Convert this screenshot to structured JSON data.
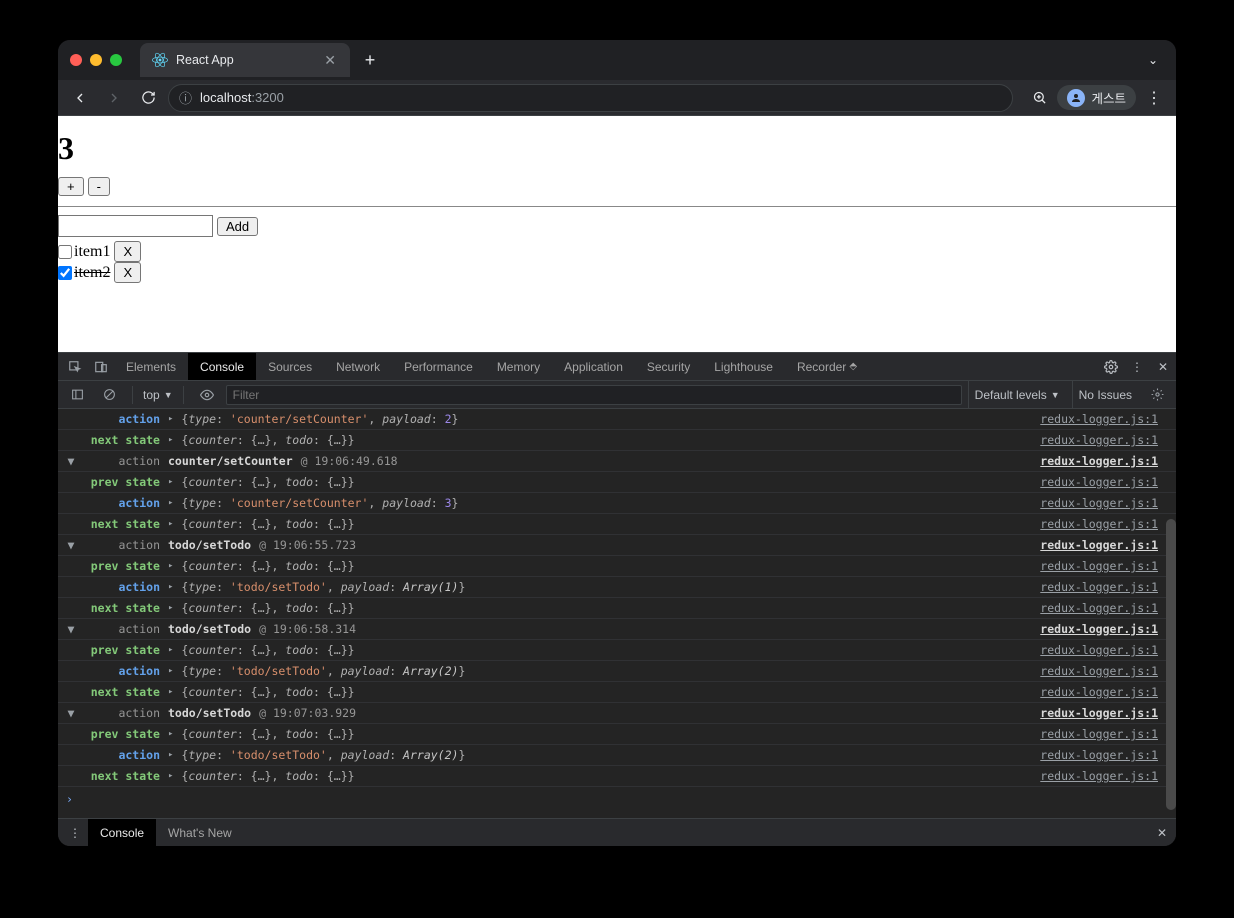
{
  "browser": {
    "tab_title": "React App",
    "url_host": "localhost",
    "url_path": ":3200",
    "guest_label": "게스트"
  },
  "app": {
    "counter": "3",
    "inc_label": "+",
    "dec_label": "-",
    "add_label": "Add",
    "todos": [
      {
        "label": "item1",
        "checked": false,
        "remove": "X"
      },
      {
        "label": "item2",
        "checked": true,
        "remove": "X"
      }
    ]
  },
  "devtools": {
    "tabs": [
      "Elements",
      "Console",
      "Sources",
      "Network",
      "Performance",
      "Memory",
      "Application",
      "Security",
      "Lighthouse",
      "Recorder"
    ],
    "active_tab": "Console",
    "context": "top",
    "filter_placeholder": "Filter",
    "levels": "Default levels",
    "issues": "No Issues",
    "drawer_tabs": [
      "Console",
      "What's New"
    ],
    "source_link": "redux-logger.js:1"
  },
  "logs": [
    {
      "kind": "sub",
      "label": "action",
      "class": "c-act",
      "body_type": "action",
      "type_str": "counter/setCounter",
      "payload_kind": "num",
      "payload": "2"
    },
    {
      "kind": "sub",
      "label": "next state",
      "class": "c-next",
      "body_type": "state"
    },
    {
      "kind": "header",
      "action": "counter/setCounter",
      "ts": "19:06:49.618"
    },
    {
      "kind": "sub",
      "label": "prev state",
      "class": "c-prev",
      "body_type": "state"
    },
    {
      "kind": "sub",
      "label": "action",
      "class": "c-act",
      "body_type": "action",
      "type_str": "counter/setCounter",
      "payload_kind": "num",
      "payload": "3"
    },
    {
      "kind": "sub",
      "label": "next state",
      "class": "c-next",
      "body_type": "state"
    },
    {
      "kind": "header",
      "action": "todo/setTodo",
      "ts": "19:06:55.723"
    },
    {
      "kind": "sub",
      "label": "prev state",
      "class": "c-prev",
      "body_type": "state"
    },
    {
      "kind": "sub",
      "label": "action",
      "class": "c-act",
      "body_type": "action",
      "type_str": "todo/setTodo",
      "payload_kind": "arr",
      "payload": "Array(1)"
    },
    {
      "kind": "sub",
      "label": "next state",
      "class": "c-next",
      "body_type": "state"
    },
    {
      "kind": "header",
      "action": "todo/setTodo",
      "ts": "19:06:58.314"
    },
    {
      "kind": "sub",
      "label": "prev state",
      "class": "c-prev",
      "body_type": "state"
    },
    {
      "kind": "sub",
      "label": "action",
      "class": "c-act",
      "body_type": "action",
      "type_str": "todo/setTodo",
      "payload_kind": "arr",
      "payload": "Array(2)"
    },
    {
      "kind": "sub",
      "label": "next state",
      "class": "c-next",
      "body_type": "state"
    },
    {
      "kind": "header",
      "action": "todo/setTodo",
      "ts": "19:07:03.929"
    },
    {
      "kind": "sub",
      "label": "prev state",
      "class": "c-prev",
      "body_type": "state"
    },
    {
      "kind": "sub",
      "label": "action",
      "class": "c-act",
      "body_type": "action",
      "type_str": "todo/setTodo",
      "payload_kind": "arr",
      "payload": "Array(2)"
    },
    {
      "kind": "sub",
      "label": "next state",
      "class": "c-next",
      "body_type": "state"
    }
  ]
}
